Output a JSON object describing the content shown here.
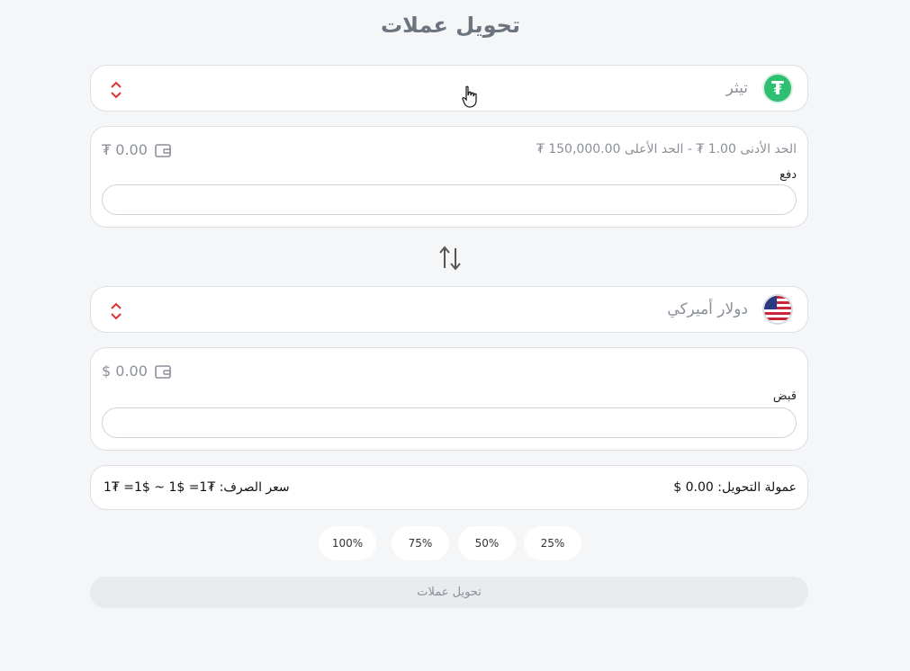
{
  "page": {
    "title": "تحويل عملات"
  },
  "from": {
    "currency_name": "تيثر",
    "balance": "₮ 0.00",
    "limits": "الحد الأدنى 1.00 ₮   -   الحد الأعلى 150,000.00 ₮",
    "field_label": "دفع",
    "input_value": "",
    "icon": "tether-icon"
  },
  "to": {
    "currency_name": "دولار أميركي",
    "balance": "$ 0.00",
    "field_label": "قبض",
    "input_value": "",
    "icon": "us-flag-icon"
  },
  "fees": {
    "commission": "عمولة التحويل: 0.00 $",
    "rate": "1₮ =1$ ~ 1$ =1₮ :سعر الصرف"
  },
  "percent_buttons": [
    "100%",
    "75%",
    "50%",
    "25%"
  ],
  "convert_button": "تحويل عملات",
  "colors": {
    "accent_chevron": "#e03030",
    "tether": "#2fbf71",
    "muted": "#8b9098"
  }
}
